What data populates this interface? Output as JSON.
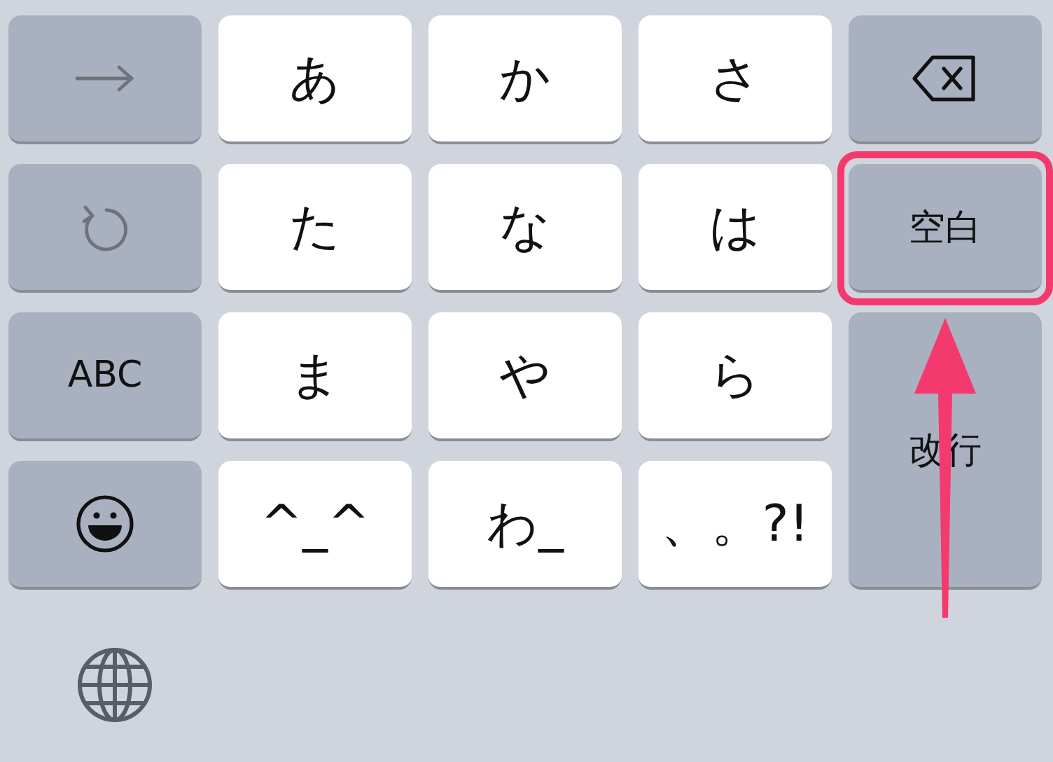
{
  "keys": [
    {
      "kind": "next"
    },
    {
      "kind": "letter",
      "label": "あ"
    },
    {
      "kind": "letter",
      "label": "か"
    },
    {
      "kind": "letter",
      "label": "さ"
    },
    {
      "kind": "delete"
    },
    {
      "kind": "undo"
    },
    {
      "kind": "letter",
      "label": "た"
    },
    {
      "kind": "letter",
      "label": "な"
    },
    {
      "kind": "letter",
      "label": "は"
    },
    {
      "kind": "function",
      "label": "空白",
      "highlighted": true
    },
    {
      "kind": "function",
      "label": "ABC"
    },
    {
      "kind": "letter",
      "label": "ま"
    },
    {
      "kind": "letter",
      "label": "や"
    },
    {
      "kind": "letter",
      "label": "ら"
    },
    {
      "kind": "return",
      "label": "改行",
      "highlighted": false
    },
    {
      "kind": "emoji"
    },
    {
      "kind": "letter",
      "label": "^_^"
    },
    {
      "kind": "letter",
      "label": "わ_"
    },
    {
      "kind": "letter",
      "label": "、。?!"
    }
  ],
  "globe": {
    "kind": "icon"
  }
}
